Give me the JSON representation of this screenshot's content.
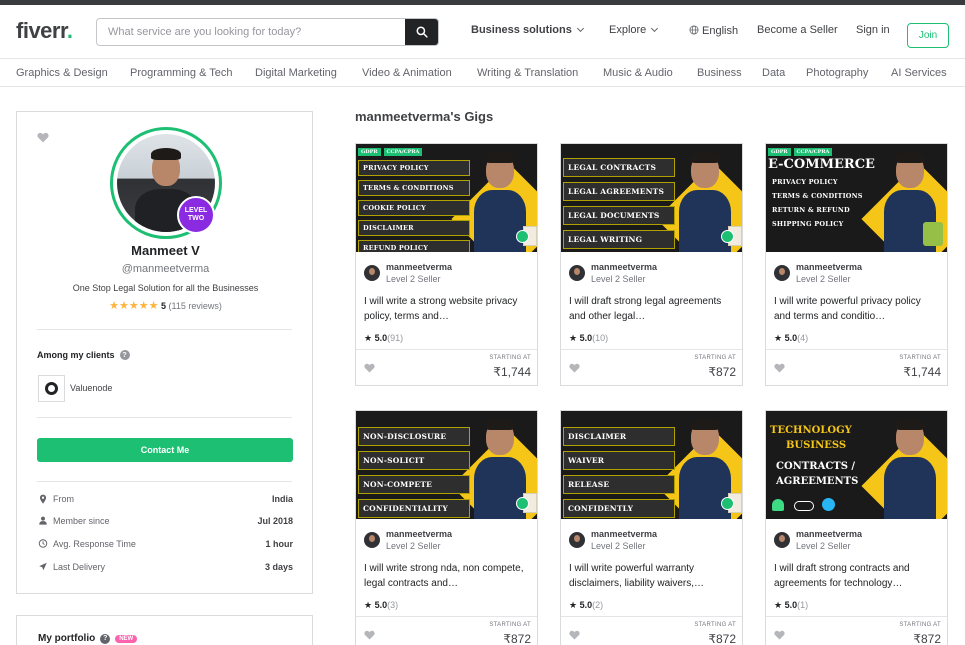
{
  "header": {
    "logo": "fiverr",
    "logo_dot": ".",
    "search_placeholder": "What service are you looking for today?",
    "nav": {
      "business": "Business solutions",
      "explore": "Explore",
      "language": "English",
      "become_seller": "Become a Seller",
      "sign_in": "Sign in",
      "join": "Join"
    }
  },
  "categories": [
    "Graphics & Design",
    "Programming & Tech",
    "Digital Marketing",
    "Video & Animation",
    "Writing & Translation",
    "Music & Audio",
    "Business",
    "Data",
    "Photography",
    "AI Services"
  ],
  "profile": {
    "level_badge_line1": "LEVEL",
    "level_badge_line2": "TWO",
    "name": "Manmeet V",
    "username": "@manmeetverma",
    "tagline": "One Stop Legal Solution for all the Businesses",
    "stars": "★★★★★",
    "rating": "5",
    "reviews": "(115 reviews)",
    "clients_heading": "Among my clients",
    "help_glyph": "?",
    "client_name": "Valuenode",
    "contact_label": "Contact Me",
    "stats": [
      {
        "label": "From",
        "value": "India"
      },
      {
        "label": "Member since",
        "value": "Jul 2018"
      },
      {
        "label": "Avg. Response Time",
        "value": "1 hour"
      },
      {
        "label": "Last Delivery",
        "value": "3 days"
      }
    ],
    "portfolio_heading": "My portfolio",
    "new_badge": "NEW"
  },
  "gigs_heading": "manmeetverma's Gigs",
  "gig_thumbs": {
    "g1": {
      "tags": [
        "GDPR",
        "CCPA/CPRA"
      ],
      "lines": [
        "PRIVACY POLICY",
        "TERMS & CONDITIONS",
        "COOKIE POLICY",
        "DISCLAIMER",
        "REFUND POLICY"
      ]
    },
    "g2": {
      "lines": [
        "LEGAL CONTRACTS",
        "LEGAL AGREEMENTS",
        "LEGAL DOCUMENTS",
        "LEGAL WRITING"
      ]
    },
    "g3": {
      "tags": [
        "GDPR",
        "CCPA/CPRA"
      ],
      "headline": "E-COMMERCE",
      "lines": [
        "PRIVACY POLICY",
        "TERMS & CONDITIONS",
        "RETURN & REFUND",
        "SHIPPING POLICY"
      ]
    },
    "g4": {
      "lines": [
        "NON-DISCLOSURE",
        "NON-SOLICIT",
        "NON-COMPETE",
        "CONFIDENTIALITY"
      ]
    },
    "g5": {
      "lines": [
        "DISCLAIMER",
        "WAIVER",
        "RELEASE",
        "CONFIDENTLY"
      ]
    },
    "g6": {
      "headline1": "TECHNOLOGY",
      "headline2": "BUSINESS",
      "line1": "CONTRACTS /",
      "line2": "AGREEMENTS"
    }
  },
  "gigs": [
    {
      "seller": "manmeetverma",
      "level": "Level 2 Seller",
      "title": "I will write a strong website privacy policy, terms and…",
      "rating": "5.0",
      "count": "(91)",
      "starting": "STARTING AT",
      "price": "₹1,744"
    },
    {
      "seller": "manmeetverma",
      "level": "Level 2 Seller",
      "title": "I will draft strong legal agreements and other legal…",
      "rating": "5.0",
      "count": "(10)",
      "starting": "STARTING AT",
      "price": "₹872"
    },
    {
      "seller": "manmeetverma",
      "level": "Level 2 Seller",
      "title": "I will write powerful privacy policy and terms and conditio…",
      "rating": "5.0",
      "count": "(4)",
      "starting": "STARTING AT",
      "price": "₹1,744"
    },
    {
      "seller": "manmeetverma",
      "level": "Level 2 Seller",
      "title": "I will write strong nda, non compete, legal contracts and…",
      "rating": "5.0",
      "count": "(3)",
      "starting": "STARTING AT",
      "price": "₹872"
    },
    {
      "seller": "manmeetverma",
      "level": "Level 2 Seller",
      "title": "I will write powerful warranty disclaimers, liability waivers,…",
      "rating": "5.0",
      "count": "(2)",
      "starting": "STARTING AT",
      "price": "₹872"
    },
    {
      "seller": "manmeetverma",
      "level": "Level 2 Seller",
      "title": "I will draft strong contracts and agreements for technology…",
      "rating": "5.0",
      "count": "(1)",
      "starting": "STARTING AT",
      "price": "₹872"
    }
  ],
  "colors": {
    "brand": "#1dbf73",
    "level_badge": "#8a2be2",
    "star": "#ffb33e",
    "new_badge": "#ff62ad"
  }
}
